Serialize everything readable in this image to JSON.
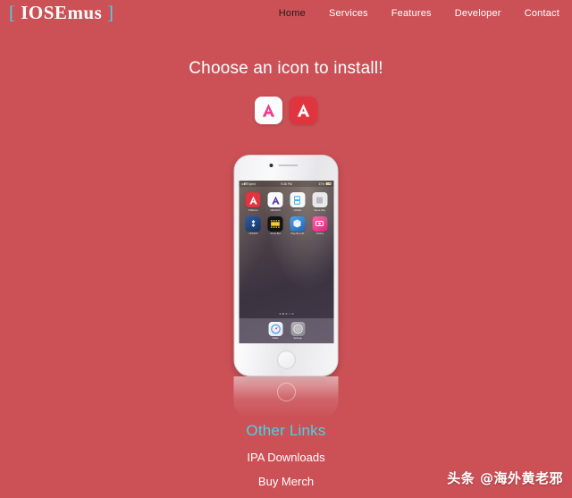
{
  "site": {
    "background_color": "#cb5156",
    "accent_cyan": "#45d4e8",
    "logo_open": "[",
    "logo_text": "IOSEmus",
    "logo_close": "]"
  },
  "nav": {
    "items": [
      {
        "label": "Home",
        "active": true
      },
      {
        "label": "Services",
        "active": false
      },
      {
        "label": "Features",
        "active": false
      },
      {
        "label": "Developer",
        "active": false
      },
      {
        "label": "Contact",
        "active": false
      }
    ]
  },
  "hero": {
    "title": "Choose an icon to install!",
    "choices": [
      {
        "name": "light-icon-choice",
        "style": "light",
        "glyph": "A",
        "bg": "#fdfdfd",
        "fg": "#ef3d8a"
      },
      {
        "name": "dark-icon-choice",
        "style": "dark",
        "glyph": "A",
        "bg": "#e0343f",
        "fg": "#ffffff"
      }
    ]
  },
  "phone": {
    "statusbar": {
      "carrier": "Sprint",
      "time": "9:38 PM",
      "battery": "67%"
    },
    "apps": [
      {
        "label": "IOSEmus",
        "glyph": "A",
        "bg": "#e0343f",
        "fg": "#ffffff"
      },
      {
        "label": "GBA4iOS",
        "glyph": "A",
        "bg": "#fbfbfd",
        "fg": "#5b3c9e"
      },
      {
        "label": "nds4ios",
        "glyph": "",
        "bg": "#f7f8fa",
        "fg": "#3fa9f5"
      },
      {
        "label": "Game Play",
        "glyph": "",
        "bg": "#e9e9ec",
        "fg": "#8f8f96"
      },
      {
        "label": "PPSSPP",
        "glyph": "",
        "bg": "#1d3f7a",
        "fg": "#ffffff"
      },
      {
        "label": "Movie Box",
        "glyph": "",
        "bg": "#141414",
        "fg": "#f2cf2e"
      },
      {
        "label": "Play Box HD",
        "glyph": "",
        "bg": "#2f7fd4",
        "fg": "#ffffff"
      },
      {
        "label": "AirShou",
        "glyph": "",
        "bg": "#ef3d8a",
        "fg": "#ffffff"
      }
    ],
    "dock": [
      {
        "label": "Safari",
        "bg": "#f3f5f8",
        "fg": "#2b8df0"
      },
      {
        "label": "Settings",
        "bg": "#9a9a9e",
        "fg": "#d8d8dc"
      }
    ],
    "page_dots": 5,
    "page_dot_active": 1
  },
  "footer": {
    "title": "Other Links",
    "links": [
      {
        "label": "IPA Downloads"
      },
      {
        "label": "Buy Merch"
      }
    ]
  },
  "watermark": {
    "text": "头条 @海外黄老邪"
  }
}
